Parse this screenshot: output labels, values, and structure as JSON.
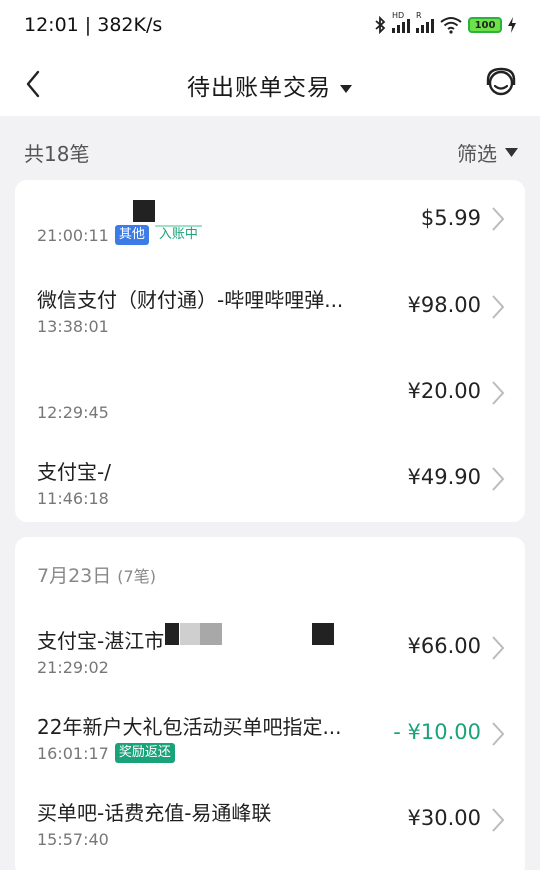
{
  "status_bar": {
    "time": "12:01 | 382K/s",
    "hd_label": "HD",
    "r_label": "R",
    "battery": "100"
  },
  "header": {
    "title": "待出账单交易"
  },
  "summary": {
    "count": "共18笔",
    "filter": "筛选"
  },
  "group1": {
    "rows": [
      {
        "name": "",
        "time": "21:00:11",
        "tags": [
          "其他",
          "入账中"
        ],
        "amount": "$5.99"
      },
      {
        "name": "微信支付（财付通）-哔哩哔哩弹...",
        "time": "13:38:01",
        "amount": "¥98.00"
      },
      {
        "name": "",
        "time": "12:29:45",
        "amount": "¥20.00"
      },
      {
        "name": "支付宝-/",
        "time": "11:46:18",
        "amount": "¥49.90"
      }
    ]
  },
  "group2": {
    "date": "7月23日",
    "count": "(7笔)",
    "rows": [
      {
        "name": "支付宝-湛江市",
        "time": "21:29:02",
        "amount": "¥66.00"
      },
      {
        "name": "22年新户大礼包活动买单吧指定...",
        "time": "16:01:17",
        "tag": "奖励返还",
        "amount": "- ¥10.00"
      },
      {
        "name": "买单吧-话费充值-易通峰联",
        "time": "15:57:40",
        "amount": "¥30.00"
      }
    ]
  },
  "colors": {
    "accent_green": "#1aa37a",
    "tag_blue": "#3d7be6",
    "background": "#f2f2f4"
  }
}
